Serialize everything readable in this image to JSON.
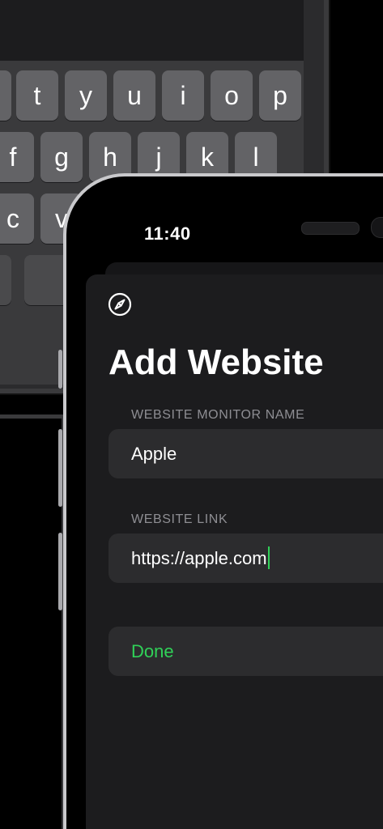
{
  "keyboard": {
    "row1": [
      "t",
      "y",
      "u",
      "i",
      "o",
      "p"
    ],
    "row2": [
      "f",
      "g",
      "h",
      "j",
      "k",
      "l"
    ],
    "row3": [
      "c",
      "v"
    ]
  },
  "status_bar": {
    "time": "11:40"
  },
  "icons": {
    "app_icon": "compass-icon"
  },
  "form": {
    "title": "Add Website",
    "name_section_label": "WEBSITE MONITOR NAME",
    "name_value": "Apple",
    "link_section_label": "WEBSITE LINK",
    "link_value": "https://apple.com",
    "done_label": "Done"
  },
  "colors": {
    "accent": "#30d158",
    "sheet_background": "#1c1c1e",
    "field_background": "#2c2c2e",
    "section_label": "#8e8e93"
  }
}
